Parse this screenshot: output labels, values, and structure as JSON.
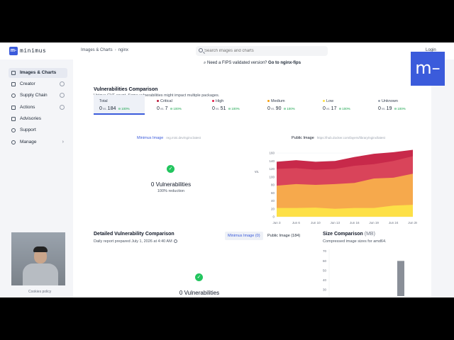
{
  "topbar": {
    "logo_mark": "m-",
    "logo_text": "minimus",
    "breadcrumb": [
      "Images & Charts",
      "nginx"
    ],
    "search_placeholder": "Search images and charts",
    "login_label": "Login"
  },
  "overlay_logo": "m–",
  "sidebar": {
    "items": [
      {
        "label": "Images & Charts",
        "active": true,
        "lock": false
      },
      {
        "label": "Creator",
        "lock": true
      },
      {
        "label": "Supply Chain",
        "lock": true
      },
      {
        "label": "Actions",
        "lock": true
      },
      {
        "label": "Advisories",
        "lock": false
      },
      {
        "label": "Support",
        "lock": false
      },
      {
        "label": "Manage",
        "lock": false,
        "chevron": true
      }
    ],
    "cookies": "Cookies policy"
  },
  "fips_banner": {
    "text": "Need a FIPS validated version?",
    "link": "Go to nginx-fips"
  },
  "vuln": {
    "title": "Vulnerabilities Comparison",
    "subtitle": "Unique CVE count. Some vulnerabilities might impact multiple packages.",
    "severities": [
      {
        "label": "Total",
        "minimus": "0",
        "public": "184",
        "pct": "100%",
        "color": ""
      },
      {
        "label": "Critical",
        "minimus": "0",
        "public": "7",
        "pct": "100%",
        "color": "#b91c3c"
      },
      {
        "label": "High",
        "minimus": "0",
        "public": "51",
        "pct": "100%",
        "color": "#e11d48"
      },
      {
        "label": "Medium",
        "minimus": "0",
        "public": "90",
        "pct": "100%",
        "color": "#f59e0b"
      },
      {
        "label": "Low",
        "minimus": "0",
        "public": "17",
        "pct": "100%",
        "color": "#fde047"
      },
      {
        "label": "Unknown",
        "minimus": "0",
        "public": "19",
        "pct": "100%",
        "color": "#9ca3af"
      }
    ],
    "vs": "vs.",
    "minimus_label": "Minimus Image",
    "minimus_path": "reg.mini.dev/nginx:latest",
    "public_label": "Public Image",
    "public_path": "https://hub.docker.com/layers/library/nginx/latest",
    "zero_title": "0 Vulnerabilities",
    "reduction": "100% reduction",
    "vs_middle": "vs."
  },
  "chart_data": {
    "type": "area",
    "x": [
      "Jun 3",
      "Jun 6",
      "Jun 10",
      "Jun 13",
      "Jun 16",
      "Jun 19",
      "Jun 24",
      "Jun 28"
    ],
    "ylim": [
      0,
      160
    ],
    "yticks": [
      0,
      20,
      40,
      60,
      80,
      100,
      120,
      140,
      160
    ],
    "series": [
      {
        "color": "#fde047",
        "values": [
          22,
          22,
          23,
          20,
          22,
          22,
          28,
          30
        ]
      },
      {
        "color": "#f6a94c",
        "values": [
          78,
          82,
          80,
          82,
          85,
          96,
          98,
          108
        ]
      },
      {
        "color": "#d9445a",
        "values": [
          120,
          122,
          118,
          120,
          128,
          132,
          140,
          152
        ]
      },
      {
        "color": "#c8294a",
        "values": [
          138,
          142,
          138,
          140,
          150,
          158,
          162,
          168
        ]
      }
    ]
  },
  "detailed": {
    "title": "Detailed Vulnerability Comparison",
    "report": "Daily report prepared July 1, 2026 at 4:40 AM",
    "tabs": [
      {
        "label": "Minimus Image (0)",
        "active": true
      },
      {
        "label": "Public Image (184)",
        "active": false
      }
    ],
    "zero_title": "0 Vulnerabilities"
  },
  "size": {
    "title": "Size Comparison",
    "unit": "(MB)",
    "subtitle": "Compressed image sizes for amd64.",
    "chart": {
      "type": "bar",
      "yticks": [
        30,
        40,
        50,
        60,
        70
      ],
      "ylim": [
        25,
        72
      ],
      "bars": [
        {
          "value": 60,
          "color": "#8a8f98"
        }
      ]
    }
  }
}
